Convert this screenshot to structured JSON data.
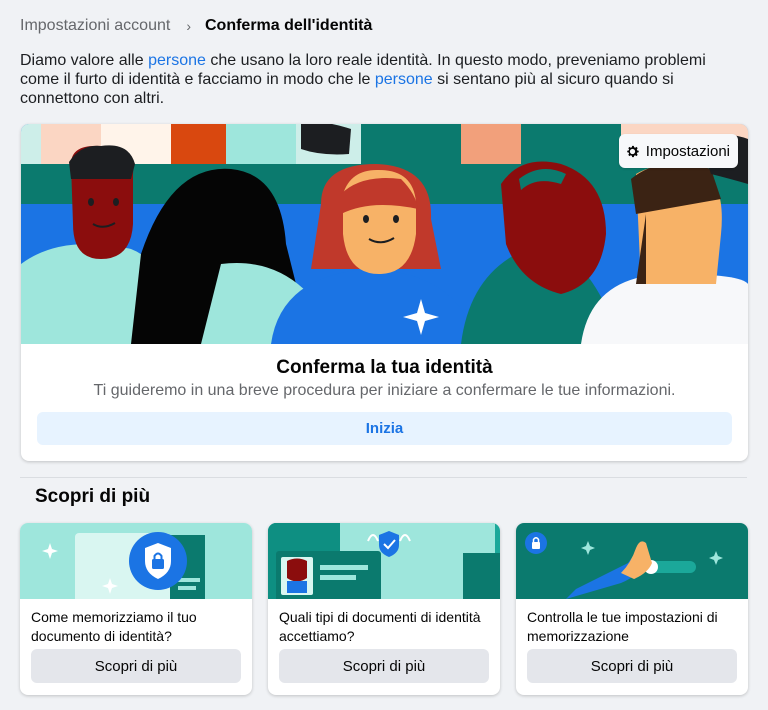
{
  "breadcrumb": {
    "parent": "Impostazioni account",
    "separator": "›",
    "current": "Conferma dell'identità"
  },
  "intro": {
    "part1": "Diamo valore alle ",
    "link1": "persone",
    "part2": " che usano la loro reale identità. In questo modo, preveniamo problemi come il furto di identità e facciamo in modo che le ",
    "link2": "persone",
    "part3": " si sentano più al sicuro quando si connettono con altri."
  },
  "hero": {
    "settings_label": "Impostazioni",
    "title": "Conferma la tua identità",
    "subtitle": "Ti guideremo in una breve procedura per iniziare a confermare le tue informazioni.",
    "start_label": "Inizia"
  },
  "learn_more": {
    "title": "Scopri di più",
    "cards": [
      {
        "text": "Come memorizziamo il tuo documento di identità?",
        "button": "Scopri di più",
        "icon": "lock-shield-icon"
      },
      {
        "text": "Quali tipi di documenti di identità accettiamo?",
        "button": "Scopri di più",
        "icon": "verified-badge-icon"
      },
      {
        "text": "Controlla le tue impostazioni di memorizzazione",
        "button": "Scopri di più",
        "icon": "toggle-hand-icon"
      }
    ]
  },
  "colors": {
    "link": "#1b74e4",
    "teal": "#0b7a6e",
    "mint": "#9ee6dc",
    "blue": "#1b74e4",
    "background": "#f0f2f5"
  }
}
